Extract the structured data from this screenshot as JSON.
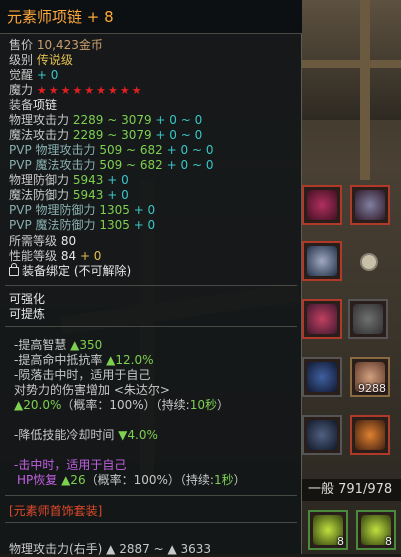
{
  "tooltip": {
    "title": "元素师项链 + 8",
    "price_label": "售价",
    "price_value": "10,423",
    "price_unit": "金币",
    "grade_label": "级别",
    "grade_value": "传说级",
    "awaken_label": "觉醒",
    "awaken_value": "+ 0",
    "magic_label": "魔力",
    "magic_stars": "★★★★★★★★★",
    "equip_label": "装备",
    "equip_value": "项链",
    "stats": [
      {
        "label": "物理攻击力",
        "base": "2289 ~ 3079",
        "bonus": " + 0 ~ 0"
      },
      {
        "label": "魔法攻击力",
        "base": "2289 ~ 3079",
        "bonus": " + 0 ~ 0"
      },
      {
        "label": "PVP 物理攻击力",
        "base": "509 ~ 682",
        "bonus": " + 0 ~ 0"
      },
      {
        "label": "PVP 魔法攻击力",
        "base": "509 ~ 682",
        "bonus": " + 0 ~ 0"
      },
      {
        "label": "物理防御力",
        "base": "5943",
        "bonus": " + 0"
      },
      {
        "label": "魔法防御力",
        "base": "5943",
        "bonus": " + 0"
      },
      {
        "label": "PVP 物理防御力",
        "base": "1305",
        "bonus": " + 0"
      },
      {
        "label": "PVP 魔法防御力",
        "base": "1305",
        "bonus": " + 0"
      }
    ],
    "req_level_label": "所需等级",
    "req_level_value": "80",
    "perf_level_label": "性能等级",
    "perf_level_value": "84",
    "perf_level_bonus": " + 0",
    "bound_text": "装备绑定 (不可解除)",
    "enhance_text": "可强化",
    "refine_text": "可提炼",
    "effects": [
      {
        "text": "-提高智慧 ",
        "val": "▲350"
      },
      {
        "text": "-提高命中抵抗率 ",
        "val": "▲12.0%"
      },
      {
        "text": "-陨落击中时，适用于自己",
        "val": ""
      }
    ],
    "effect_line4": " 对势力的伤害增加 <朱达尔>",
    "effect_line5_val": "▲20.0%",
    "effect_line5_rest": "（概率：100%）（持续:",
    "effect_line5_dur": "10秒",
    "effect_line5_end": "）",
    "cooldown_text": "-降低技能冷却时间 ",
    "cooldown_val": "▼4.0%",
    "hit_text": "-击中时，适用于自己",
    "hp_label": "HP恢复 ",
    "hp_val": "▲26",
    "hp_rest": "（概率：100%）（持续:",
    "hp_dur": "1秒",
    "hp_end": "）",
    "set_name": "[元素师首饰套装]",
    "next_line": "物理攻击力(右手) ▲ 2887 ~ ▲ 3633"
  },
  "inventory": {
    "label": "一般 791/978",
    "count_1": "9288",
    "count_2": "8",
    "count_3": "8"
  }
}
